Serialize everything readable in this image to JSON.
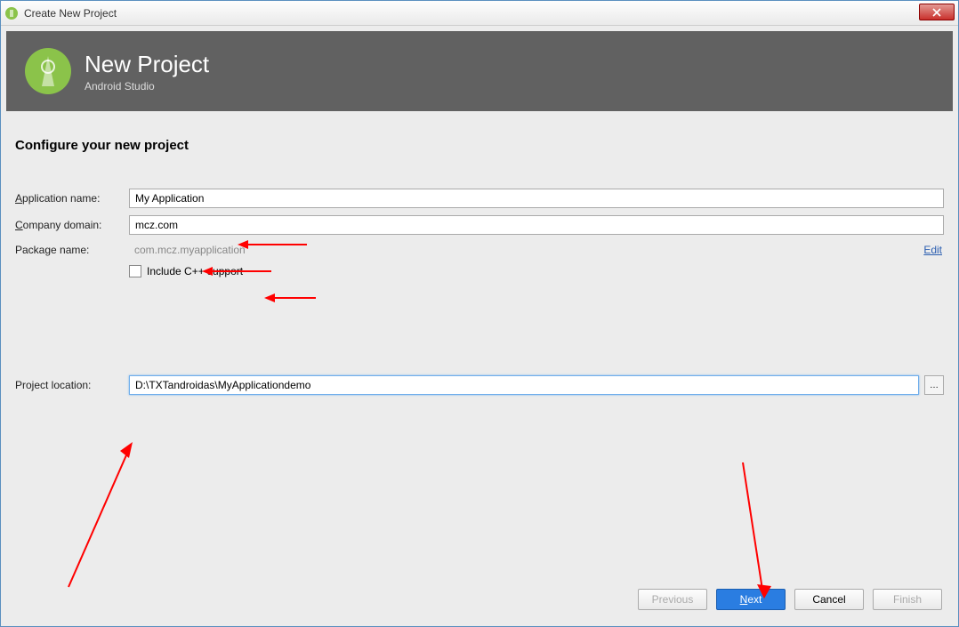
{
  "window": {
    "title": "Create New Project"
  },
  "header": {
    "title": "New Project",
    "subtitle": "Android Studio"
  },
  "section_title": "Configure your new project",
  "labels": {
    "app_name": "Application name:",
    "company_domain": "Company domain:",
    "package_name": "Package name:",
    "project_location": "Project location:",
    "include_cpp": "Include C++ support"
  },
  "values": {
    "app_name": "My Application",
    "company_domain": "mcz.com",
    "package_name": "com.mcz.myapplication",
    "project_location": "D:\\TXTandroidas\\MyApplicationdemo"
  },
  "links": {
    "edit": "Edit"
  },
  "buttons": {
    "previous": "Previous",
    "next": "Next",
    "cancel": "Cancel",
    "finish": "Finish",
    "browse": "…"
  }
}
